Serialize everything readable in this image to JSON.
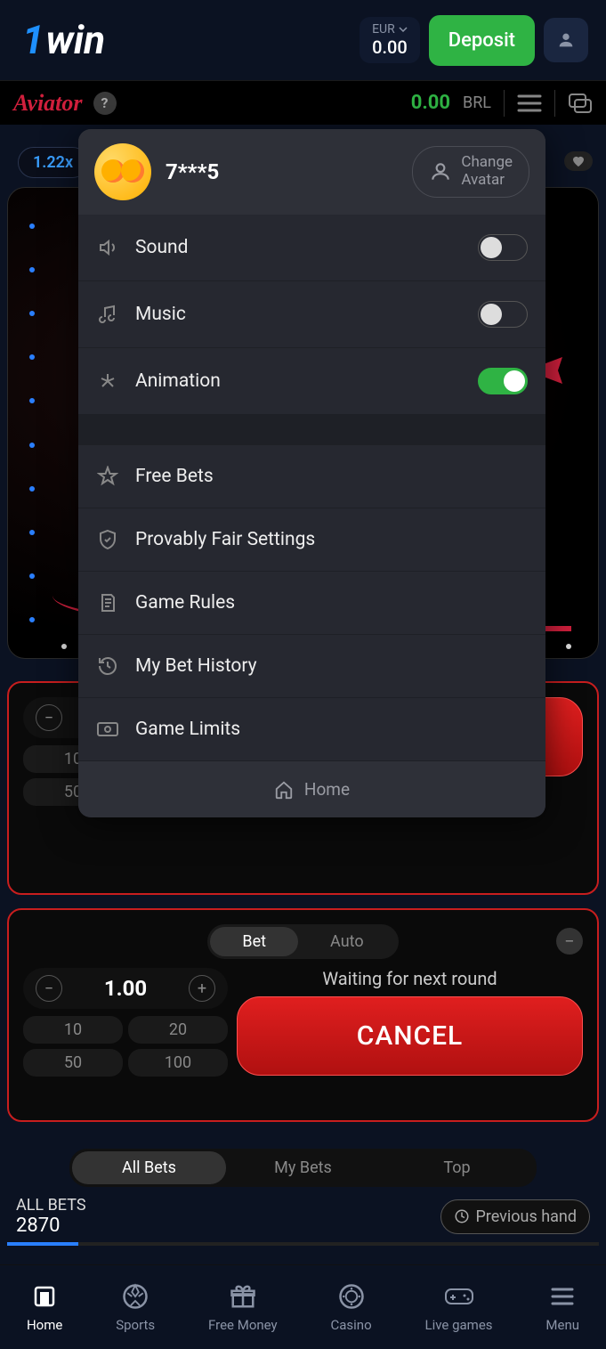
{
  "header": {
    "logo_text": "win",
    "currency_code": "EUR",
    "currency_amount": "0.00",
    "deposit_label": "Deposit"
  },
  "aviator": {
    "logo": "Aviator",
    "balance": "0.00",
    "balance_currency": "BRL"
  },
  "multiplier": "1.22x",
  "menu": {
    "username": "7***5",
    "change_avatar_line1": "Change",
    "change_avatar_line2": "Avatar",
    "items": {
      "sound": {
        "label": "Sound",
        "on": false
      },
      "music": {
        "label": "Music",
        "on": false
      },
      "animation": {
        "label": "Animation",
        "on": true
      },
      "free_bets": {
        "label": "Free Bets"
      },
      "provably_fair": {
        "label": "Provably Fair Settings"
      },
      "game_rules": {
        "label": "Game Rules"
      },
      "bet_history": {
        "label": "My Bet History"
      },
      "game_limits": {
        "label": "Game Limits"
      }
    },
    "home_label": "Home"
  },
  "bet": {
    "tab_bet": "Bet",
    "tab_auto": "Auto",
    "amount": "1.00",
    "presets": [
      "10",
      "20",
      "50",
      "100"
    ],
    "waiting": "Waiting for next round",
    "cancel": "CANCEL"
  },
  "bets_section": {
    "tabs": {
      "all": "All Bets",
      "my": "My Bets",
      "top": "Top"
    },
    "all_bets_label": "ALL BETS",
    "count": "2870",
    "previous_hand": "Previous hand"
  },
  "nav": {
    "home": "Home",
    "sports": "Sports",
    "free_money": "Free Money",
    "casino": "Casino",
    "live_games": "Live games",
    "menu": "Menu"
  }
}
